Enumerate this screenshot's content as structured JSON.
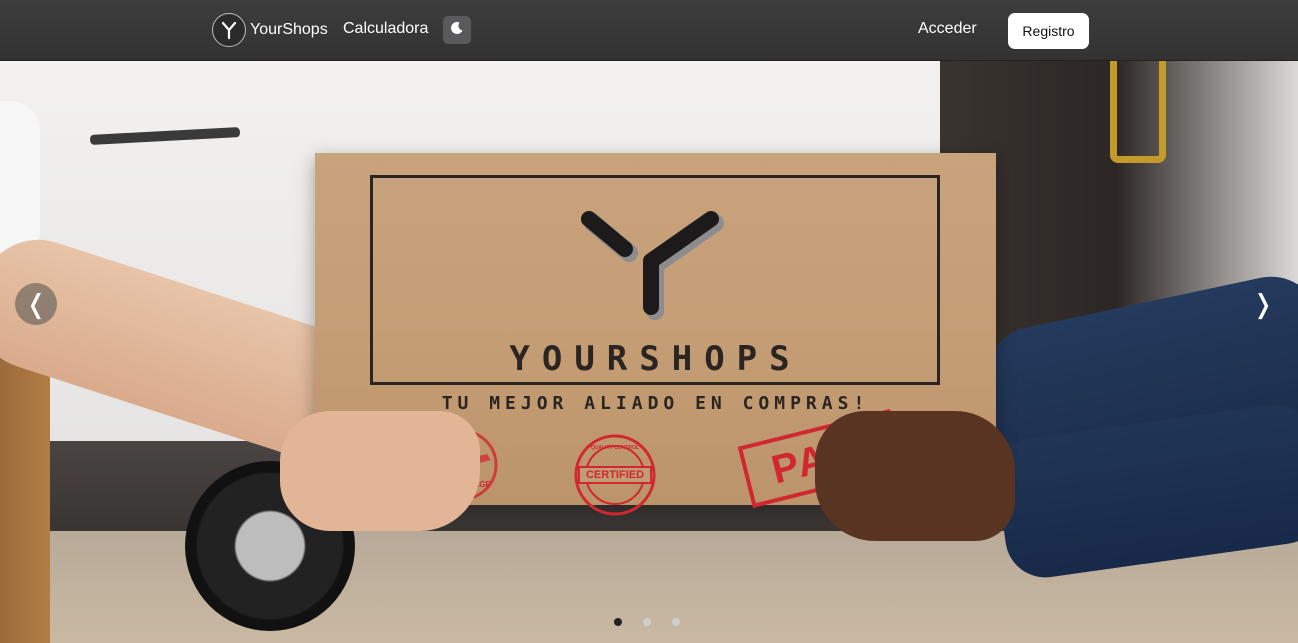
{
  "navbar": {
    "brand_name": "YourShops",
    "links": [
      {
        "label": "Calculadora"
      }
    ],
    "theme_toggle_icon": "moon-icon",
    "login_label": "Acceder",
    "register_label": "Registro"
  },
  "hero": {
    "box_title": "YOURSHOPS",
    "box_tagline": "TU MEJOR ALIADO EN COMPRAS!",
    "stamps": {
      "left": "BON VOYAGE",
      "center": "CERTIFIED",
      "center_top": "QUALITY CONTROL",
      "right": "PAID"
    },
    "carousel": {
      "prev_icon": "chevron-left-icon",
      "next_icon": "chevron-right-icon",
      "prev_glyph": "❬",
      "next_glyph": "❭",
      "slide_count": 3,
      "active_slide": 1
    }
  },
  "colors": {
    "navbar_bg": "#3a3939",
    "register_bg": "#ffffff",
    "stamp_red": "#d1282f",
    "box_brown": "#c49c74"
  }
}
